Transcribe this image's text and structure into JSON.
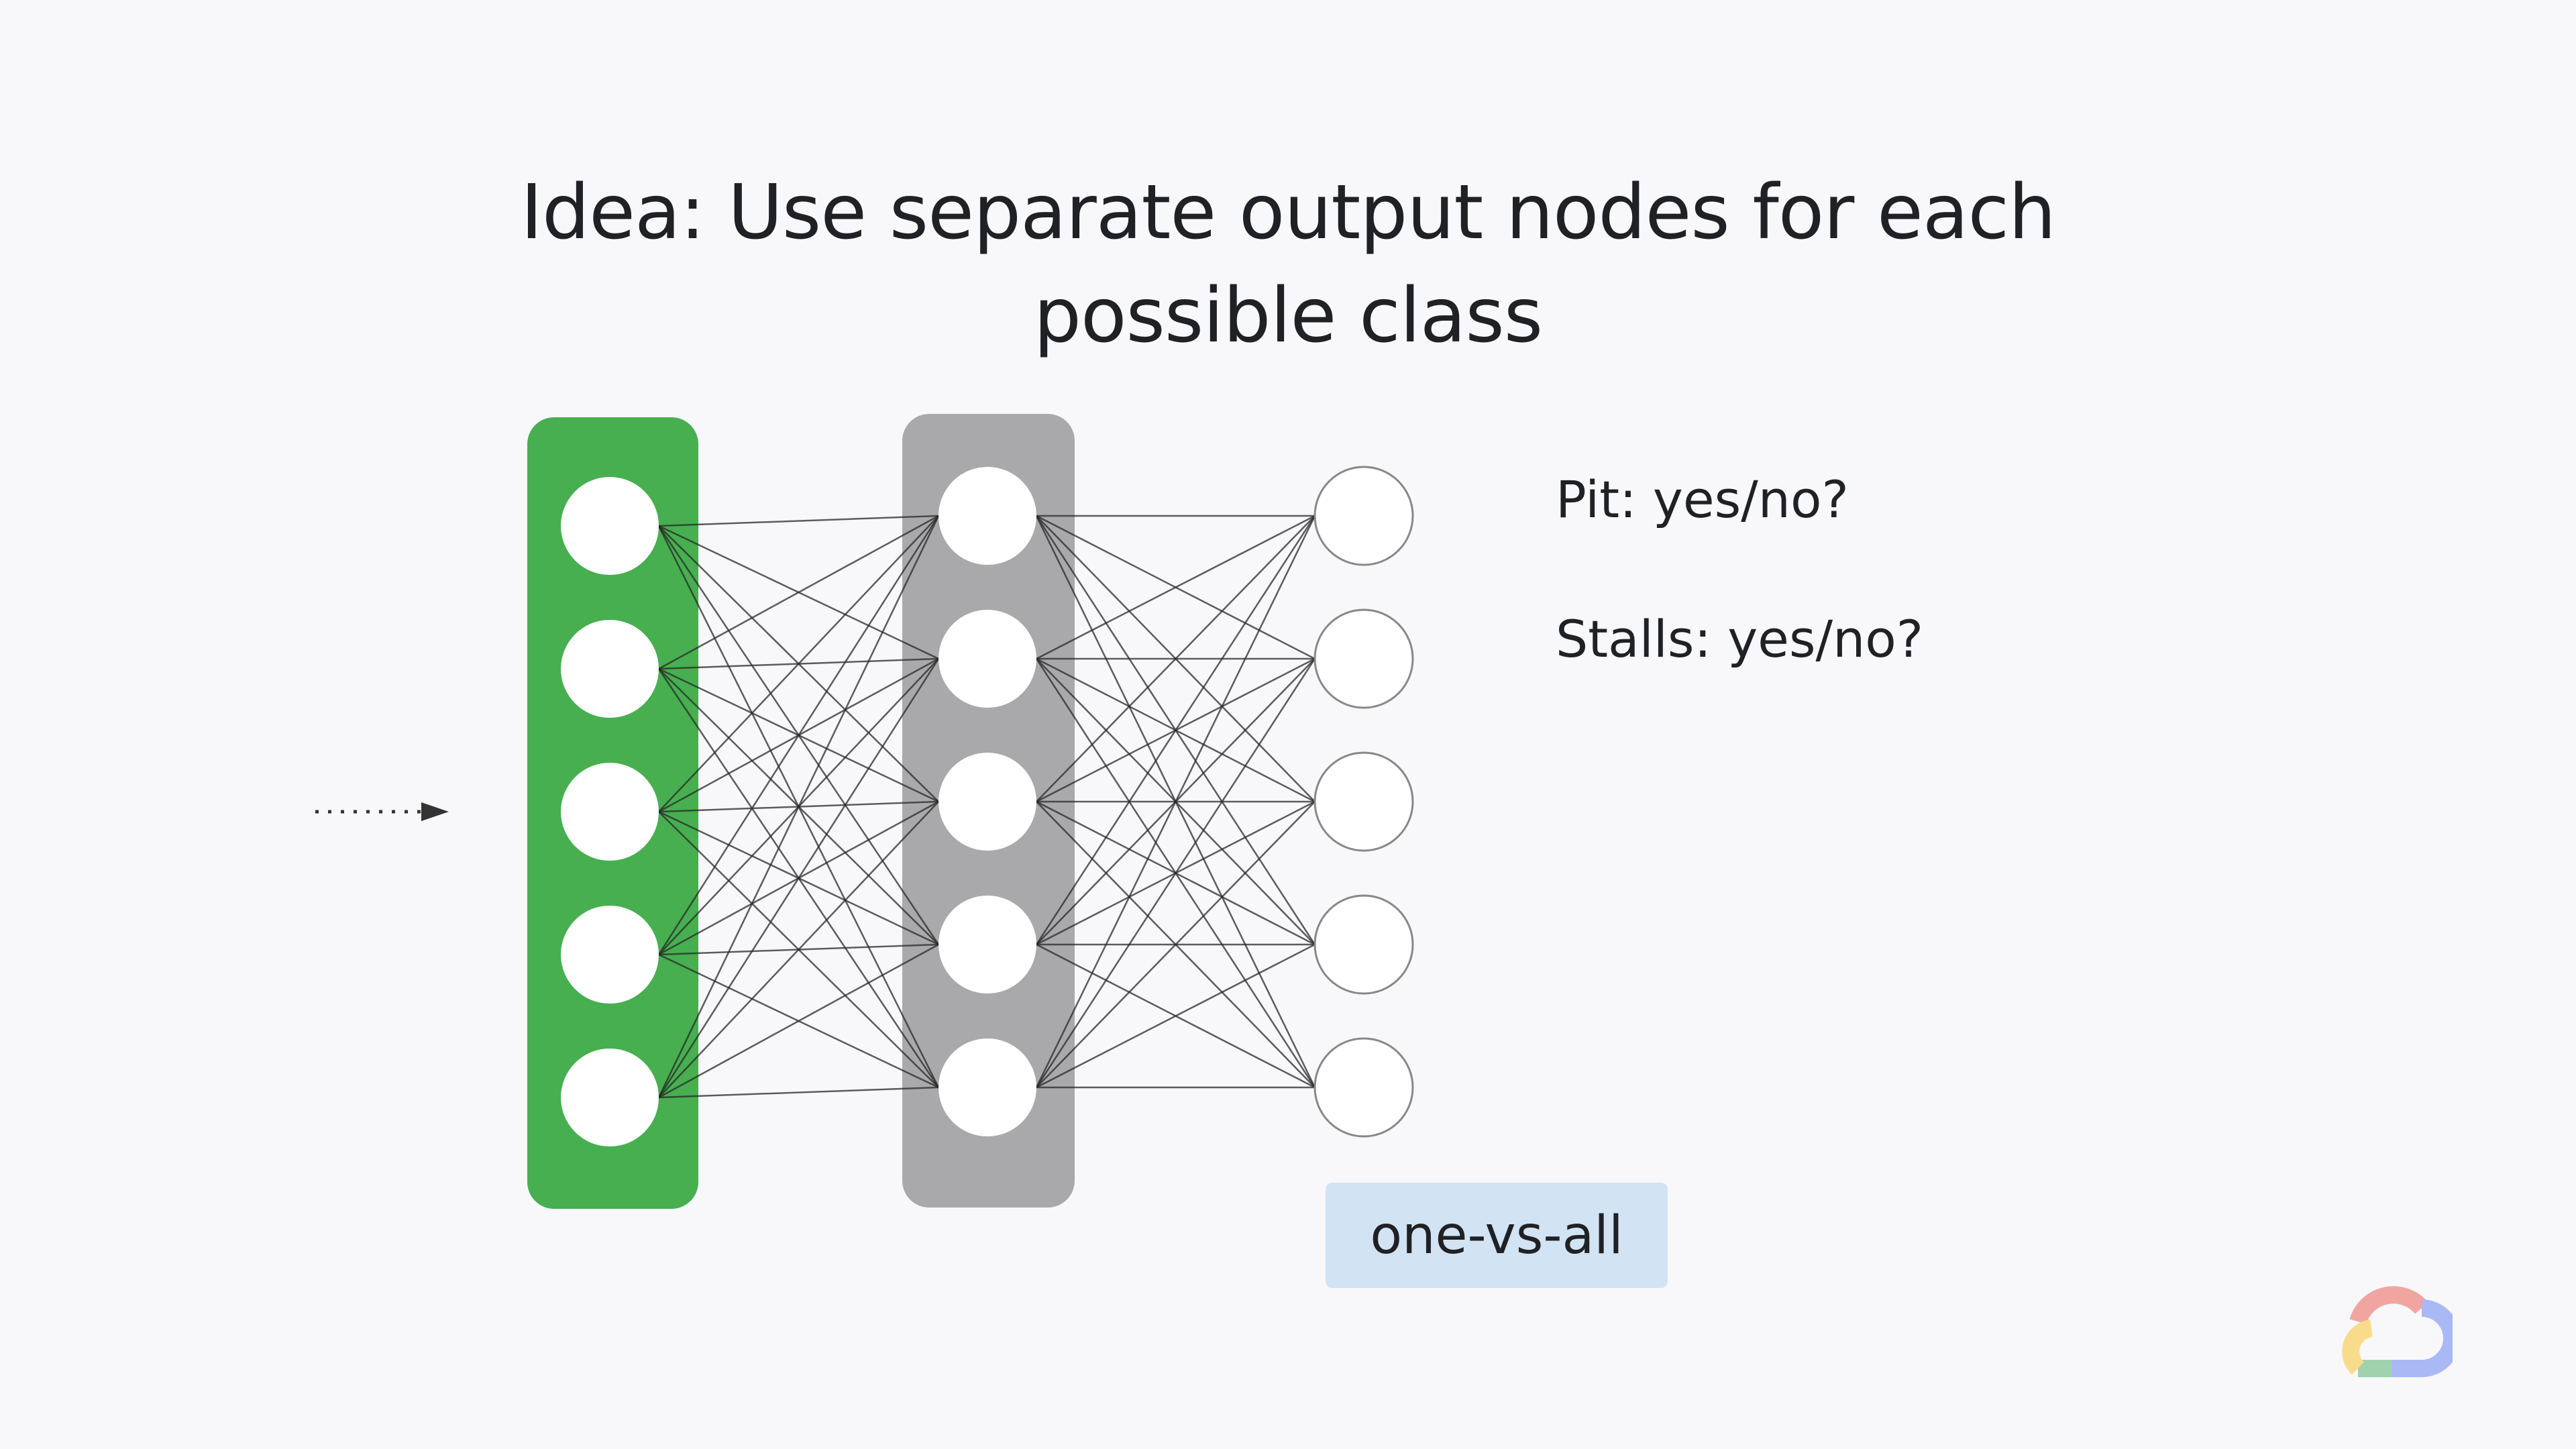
{
  "title": {
    "line1": "Idea: Use separate output nodes for each",
    "line2": "possible class"
  },
  "labels": [
    "Pit: yes/no?",
    "Stalls: yes/no?"
  ],
  "tag": "one-vs-all",
  "network": {
    "input_nodes": 5,
    "hidden_nodes": 5,
    "output_nodes": 5
  },
  "colors": {
    "input_layer": "#47af50",
    "hidden_layer": "#a9a9ab",
    "tag_bg": "#d2e3f3",
    "background": "#f8f8fb"
  },
  "logo": "google-cloud-logo"
}
